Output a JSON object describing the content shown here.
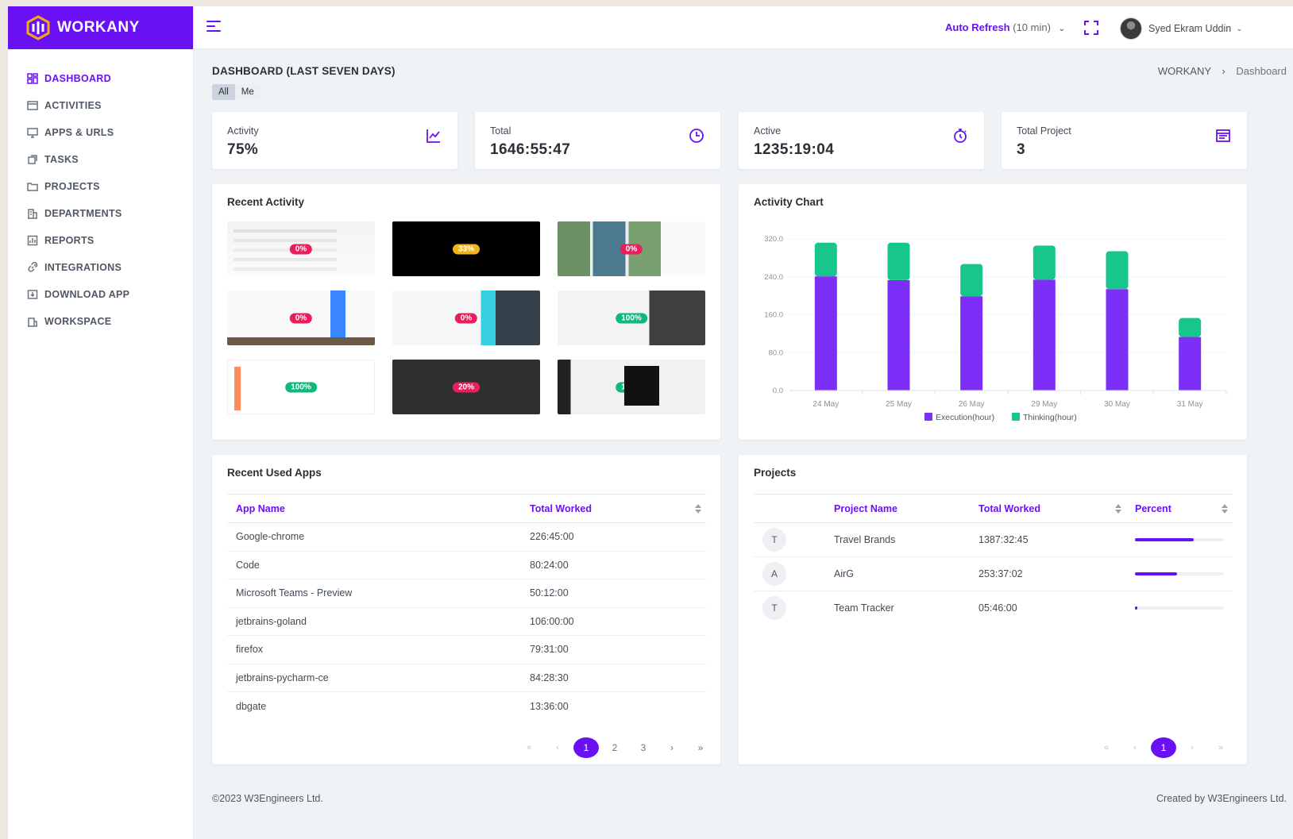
{
  "brand": {
    "name": "WORKANY",
    "accent": "#6a11f3"
  },
  "sidebar": {
    "items": [
      {
        "label": "DASHBOARD",
        "icon": "dashboard-icon",
        "active": true
      },
      {
        "label": "ACTIVITIES",
        "icon": "activities-icon"
      },
      {
        "label": "APPS & URLS",
        "icon": "monitor-icon"
      },
      {
        "label": "TASKS",
        "icon": "tasks-icon"
      },
      {
        "label": "PROJECTS",
        "icon": "folder-icon"
      },
      {
        "label": "DEPARTMENTS",
        "icon": "building-icon"
      },
      {
        "label": "REPORTS",
        "icon": "report-icon"
      },
      {
        "label": "INTEGRATIONS",
        "icon": "link-icon"
      },
      {
        "label": "DOWNLOAD APP",
        "icon": "download-icon"
      },
      {
        "label": "WORKSPACE",
        "icon": "workspace-icon"
      }
    ]
  },
  "header": {
    "auto_refresh_label": "Auto Refresh",
    "auto_refresh_interval": "(10 min)",
    "user_name": "Syed Ekram Uddin"
  },
  "page": {
    "title": "DASHBOARD (LAST SEVEN DAYS)",
    "breadcrumb": [
      "WORKANY",
      "Dashboard"
    ],
    "filter_tabs": [
      "All",
      "Me"
    ],
    "filter_selected": "All"
  },
  "stats": [
    {
      "label": "Activity",
      "value": "75%",
      "icon": "line-chart-icon"
    },
    {
      "label": "Total",
      "value": "1646:55:47",
      "icon": "clock-icon"
    },
    {
      "label": "Active",
      "value": "1235:19:04",
      "icon": "stopwatch-icon"
    },
    {
      "label": "Total Project",
      "value": "3",
      "icon": "report-icon"
    }
  ],
  "recent_activity": {
    "title": "Recent Activity",
    "screenshots": [
      {
        "percent": "0%",
        "badge_color": "#ea1e5b"
      },
      {
        "percent": "33%",
        "badge_color": "#f4b51b"
      },
      {
        "percent": "0%",
        "badge_color": "#ea1e5b"
      },
      {
        "percent": "0%",
        "badge_color": "#ea1e5b"
      },
      {
        "percent": "0%",
        "badge_color": "#ea1e5b"
      },
      {
        "percent": "100%",
        "badge_color": "#0fb97c"
      },
      {
        "percent": "100%",
        "badge_color": "#0fb97c"
      },
      {
        "percent": "20%",
        "badge_color": "#ea1e5b"
      },
      {
        "percent": "100%",
        "badge_color": "#0fb97c"
      }
    ]
  },
  "activity_chart": {
    "title": "Activity Chart"
  },
  "chart_data": {
    "type": "bar",
    "stacked": true,
    "categories": [
      "24 May",
      "25 May",
      "26 May",
      "29 May",
      "30 May",
      "31 May"
    ],
    "series": [
      {
        "name": "Execution(hour)",
        "color": "#7b2ff7",
        "values": [
          241,
          233,
          199,
          234,
          214,
          113
        ]
      },
      {
        "name": "Thinking(hour)",
        "color": "#17c68c",
        "values": [
          71,
          79,
          68,
          72,
          80,
          40
        ]
      }
    ],
    "ylim": [
      0,
      320
    ],
    "yticks": [
      "0.0",
      "80.0",
      "160.0",
      "240.0",
      "320.0"
    ],
    "grid": true,
    "legend": "bottom"
  },
  "recent_apps": {
    "title": "Recent Used Apps",
    "columns": [
      "App Name",
      "Total Worked"
    ],
    "rows": [
      [
        "Google-chrome",
        "226:45:00"
      ],
      [
        "Code",
        "80:24:00"
      ],
      [
        "Microsoft Teams - Preview",
        "50:12:00"
      ],
      [
        "jetbrains-goland",
        "106:00:00"
      ],
      [
        "firefox",
        "79:31:00"
      ],
      [
        "jetbrains-pycharm-ce",
        "84:28:30"
      ],
      [
        "dbgate",
        "13:36:00"
      ]
    ],
    "pagination": {
      "first": "«",
      "prev": "‹",
      "pages": [
        "1",
        "2",
        "3"
      ],
      "current": "1",
      "next": "›",
      "last": "»"
    }
  },
  "projects": {
    "title": "Projects",
    "columns": [
      "Project Name",
      "Total Worked",
      "Percent"
    ],
    "rows": [
      {
        "letter": "T",
        "name": "Travel Brands",
        "worked": "1387:32:45",
        "percent": 0.66
      },
      {
        "letter": "A",
        "name": "AirG",
        "worked": "253:37:02",
        "percent": 0.47
      },
      {
        "letter": "T",
        "name": "Team Tracker",
        "worked": "05:46:00",
        "percent": 0.03
      }
    ],
    "pagination": {
      "first": "«",
      "prev": "‹",
      "pages": [
        "1"
      ],
      "current": "1",
      "next": "›",
      "last": "»"
    }
  },
  "footer": {
    "copyright": "©2023 W3Engineers Ltd.",
    "credit": "Created by W3Engineers Ltd."
  }
}
